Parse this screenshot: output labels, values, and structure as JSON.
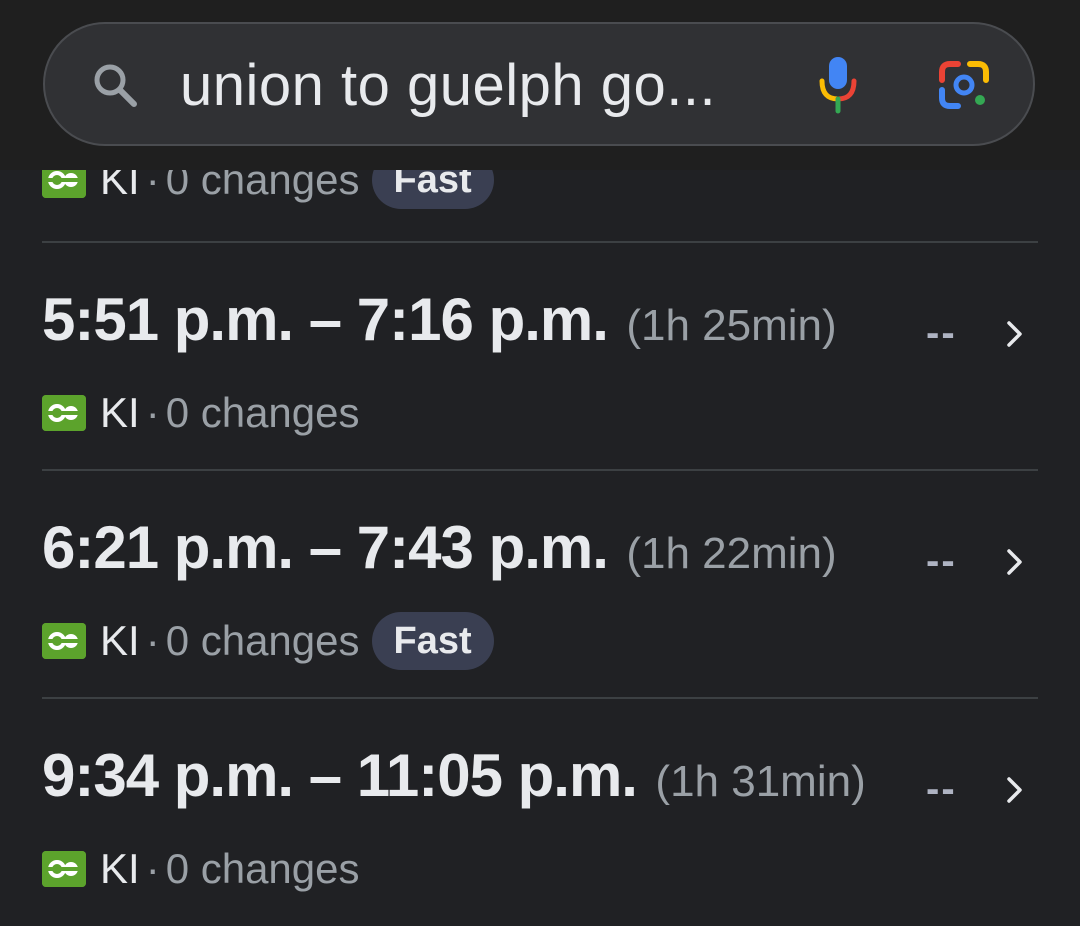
{
  "search": {
    "query": "union to guelph go...",
    "icons": {
      "search": "search-icon",
      "voice": "mic-icon",
      "lens": "lens-icon"
    }
  },
  "partial_result": {
    "line": "KI",
    "separator": "·",
    "changes": "0 changes",
    "badge": "Fast"
  },
  "results": [
    {
      "times": "5:51 p.m. – 7:16 p.m.",
      "duration": "(1h 25min)",
      "fare": "--",
      "line": "KI",
      "separator": "·",
      "changes": "0 changes",
      "badge": ""
    },
    {
      "times": "6:21 p.m. – 7:43 p.m.",
      "duration": "(1h 22min)",
      "fare": "--",
      "line": "KI",
      "separator": "·",
      "changes": "0 changes",
      "badge": "Fast"
    },
    {
      "times": "9:34 p.m. – 11:05 p.m.",
      "duration": "(1h 31min)",
      "fare": "--",
      "line": "KI",
      "separator": "·",
      "changes": "0 changes",
      "badge": ""
    }
  ],
  "colors": {
    "background": "#202124",
    "go_transit_green": "#5ca32c",
    "badge_background": "#3a3f52",
    "secondary_text": "#9aa0a6"
  }
}
